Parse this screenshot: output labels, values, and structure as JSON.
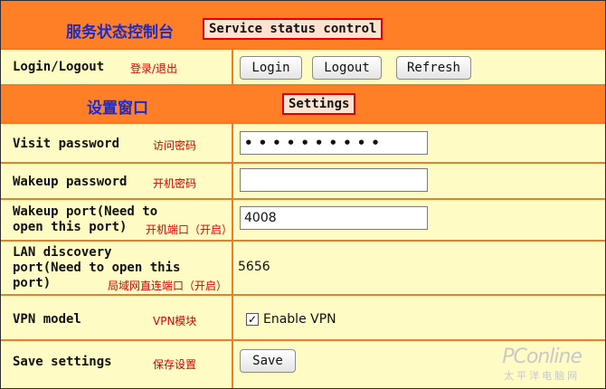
{
  "header1": {
    "title_cn": "服务状态控制台",
    "title_en": "Service status control"
  },
  "login_row": {
    "label_en": "Login/Logout",
    "label_cn": "登录/退出",
    "buttons": {
      "login": "Login",
      "logout": "Logout",
      "refresh": "Refresh"
    }
  },
  "header2": {
    "title_cn": "设置窗口",
    "title_en": "Settings"
  },
  "visit": {
    "label_en": "Visit password",
    "label_cn": "访问密码",
    "value": "••••••••••"
  },
  "wakeup": {
    "label_en": "Wakeup password",
    "label_cn": "开机密码",
    "value": ""
  },
  "wakeport": {
    "label_en_1": "Wakeup port(Need to",
    "label_en_2": "open this port)",
    "label_cn": "开机端口（开启）",
    "value": "4008"
  },
  "lan": {
    "label_en_1": "LAN discovery",
    "label_en_2": "port(Need to open this",
    "label_en_3": "port)",
    "label_cn": "局域网直连端口（开启）",
    "value": "5656"
  },
  "vpn": {
    "label_en": "VPN model",
    "label_cn": "VPN模块",
    "checkbox_label": "Enable VPN",
    "checked": true,
    "check_mark": "✓"
  },
  "save": {
    "label_en": "Save settings",
    "label_cn": "保存设置",
    "button": "Save"
  },
  "watermark": {
    "brand": "PConline",
    "brand_cn": "太平洋电脑网"
  },
  "colors": {
    "header_orange": "#ff7f27",
    "cell_yellow": "#fffbc4",
    "border_orange": "#ee7d2a",
    "red_text": "#d40000",
    "blue_text": "#1a2ccc"
  }
}
